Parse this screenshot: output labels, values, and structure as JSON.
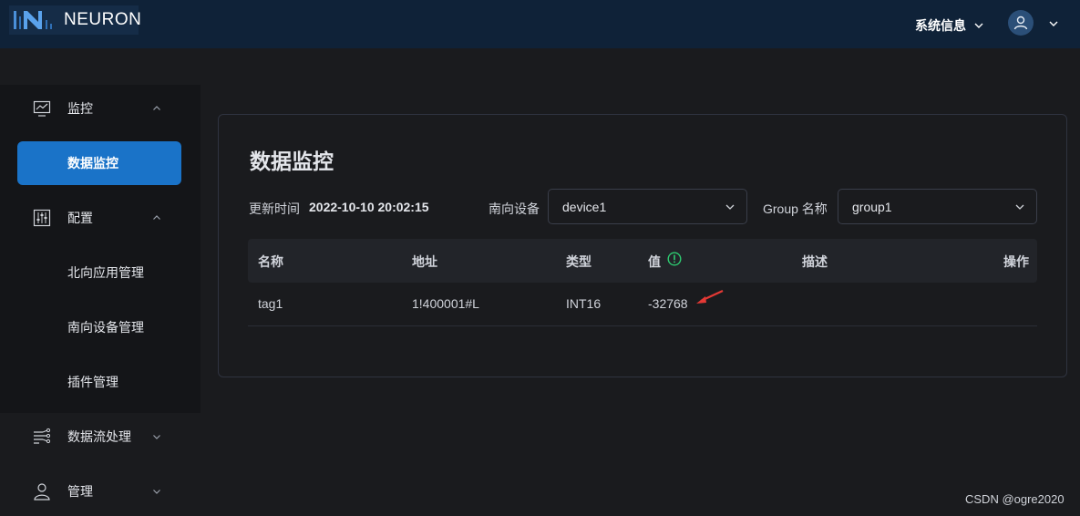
{
  "header": {
    "logo_text": "NEURON",
    "system_info_label": "系统信息"
  },
  "sidebar": {
    "groups": [
      {
        "label": "监控",
        "icon": "monitor-chart-icon",
        "expanded": true
      },
      {
        "label": "配置",
        "icon": "sliders-icon",
        "expanded": true
      },
      {
        "label": "数据流处理",
        "icon": "dataflow-icon",
        "expanded": false
      },
      {
        "label": "管理",
        "icon": "user-icon",
        "expanded": false
      }
    ],
    "sub_items": [
      {
        "label": "数据监控",
        "active": true
      },
      {
        "label": "北向应用管理",
        "active": false
      },
      {
        "label": "南向设备管理",
        "active": false
      },
      {
        "label": "插件管理",
        "active": false
      }
    ]
  },
  "main": {
    "title": "数据监控",
    "update_time_label": "更新时间",
    "update_time_value": "2022-10-10 20:02:15",
    "south_device_label": "南向设备",
    "south_device_value": "device1",
    "group_label": "Group 名称",
    "group_value": "group1",
    "table": {
      "columns": [
        "名称",
        "地址",
        "类型",
        "值",
        "描述",
        "操作"
      ],
      "rows": [
        {
          "name": "tag1",
          "address": "1!400001#L",
          "type": "INT16",
          "value": "-32768",
          "description": "",
          "action": ""
        }
      ]
    }
  },
  "watermark": "CSDN @ogre2020",
  "colors": {
    "header_bg": "#0f2238",
    "accent": "#1a73c8",
    "info_icon": "#2ecc71",
    "annotation_arrow": "#e53935"
  }
}
